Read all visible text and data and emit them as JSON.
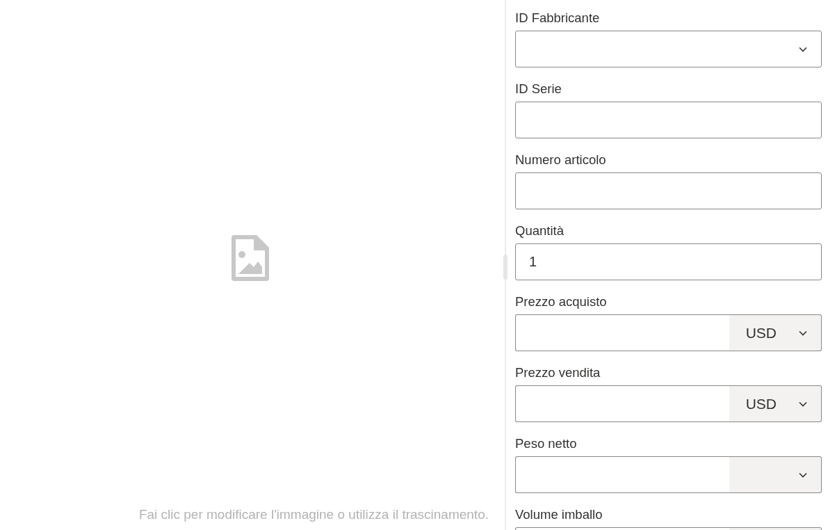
{
  "image_panel": {
    "hint": "Fai clic per modificare l'immagine o utilizza il trascinamento."
  },
  "fields": [
    {
      "label": "ID Fabbricante",
      "kind": "select"
    },
    {
      "label": "ID Serie",
      "kind": "text"
    },
    {
      "label": "Numero articolo",
      "kind": "text"
    },
    {
      "label": "Quantità",
      "kind": "text",
      "value": "1"
    },
    {
      "label": "Prezzo acquisto",
      "kind": "unit",
      "unit": "USD"
    },
    {
      "label": "Prezzo vendita",
      "kind": "unit",
      "unit": "USD"
    },
    {
      "label": "Peso netto",
      "kind": "unit"
    },
    {
      "label": "Volume imballo",
      "kind": "unit"
    }
  ]
}
